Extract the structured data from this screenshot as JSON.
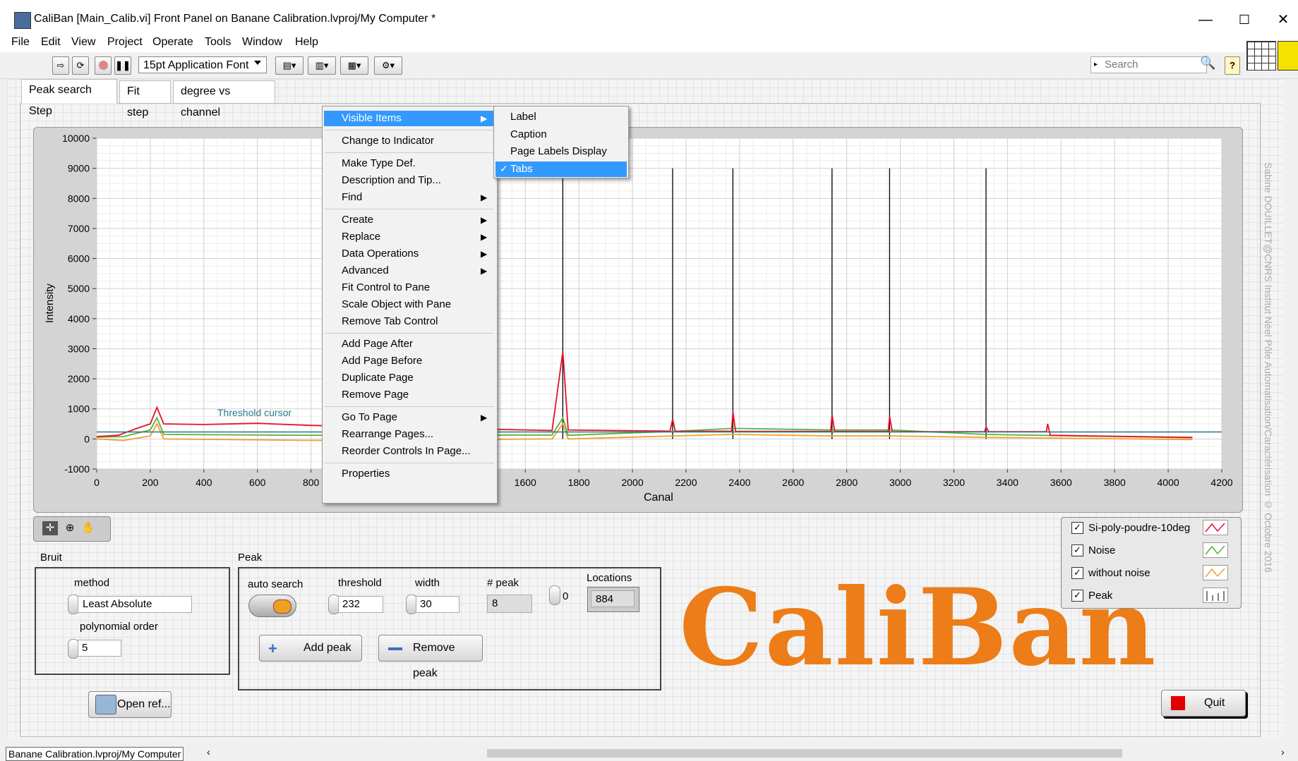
{
  "window": {
    "title": "CaliBan [Main_Calib.vi] Front Panel on Banane Calibration.lvproj/My Computer *",
    "minimize": "—",
    "maximize": "☐",
    "close": "✕"
  },
  "menubar": [
    "File",
    "Edit",
    "View",
    "Project",
    "Operate",
    "Tools",
    "Window",
    "Help"
  ],
  "toolbar": {
    "font": "15pt Application Font",
    "search_placeholder": "Search",
    "help": "?"
  },
  "tabs": [
    "Peak search Step",
    "Fit step",
    "degree vs channel"
  ],
  "graph": {
    "ylabel": "Intensity",
    "xlabel": "Canal",
    "threshold_label": "Threshold cursor",
    "yticks": [
      "10000",
      "9000",
      "8000",
      "7000",
      "6000",
      "5000",
      "4000",
      "3000",
      "2000",
      "1000",
      "0",
      "-1000"
    ],
    "xticks": [
      "0",
      "200",
      "400",
      "600",
      "800",
      "1000",
      "1200",
      "1400",
      "1600",
      "1800",
      "2000",
      "2200",
      "2400",
      "2600",
      "2800",
      "3000",
      "3200",
      "3400",
      "3600",
      "3800",
      "4000",
      "4200"
    ]
  },
  "chart_data": {
    "type": "line",
    "xlabel": "Canal",
    "ylabel": "Intensity",
    "xlim": [
      0,
      4200
    ],
    "ylim": [
      -1000,
      10000
    ],
    "threshold": 232,
    "peak_markers_x": [
      1740,
      2150,
      2375,
      2745,
      2960,
      3320
    ],
    "series": [
      {
        "name": "Si-poly-poudre-10deg",
        "color": "#e8102a",
        "points": [
          [
            0,
            80
          ],
          [
            80,
            120
          ],
          [
            150,
            350
          ],
          [
            200,
            500
          ],
          [
            225,
            1050
          ],
          [
            250,
            500
          ],
          [
            400,
            480
          ],
          [
            600,
            520
          ],
          [
            800,
            450
          ],
          [
            1700,
            280
          ],
          [
            1740,
            2900
          ],
          [
            1760,
            300
          ],
          [
            2140,
            260
          ],
          [
            2150,
            650
          ],
          [
            2160,
            250
          ],
          [
            2370,
            260
          ],
          [
            2375,
            900
          ],
          [
            2385,
            250
          ],
          [
            2740,
            250
          ],
          [
            2745,
            800
          ],
          [
            2755,
            250
          ],
          [
            2955,
            250
          ],
          [
            2960,
            750
          ],
          [
            2970,
            240
          ],
          [
            3315,
            240
          ],
          [
            3320,
            400
          ],
          [
            3330,
            240
          ],
          [
            3545,
            240
          ],
          [
            3550,
            500
          ],
          [
            3560,
            120
          ],
          [
            4090,
            50
          ]
        ]
      },
      {
        "name": "Noise",
        "color": "#5cb03c",
        "points": [
          [
            0,
            60
          ],
          [
            100,
            80
          ],
          [
            200,
            300
          ],
          [
            225,
            700
          ],
          [
            250,
            150
          ],
          [
            800,
            120
          ],
          [
            1700,
            130
          ],
          [
            1740,
            700
          ],
          [
            1760,
            120
          ],
          [
            2150,
            250
          ],
          [
            2375,
            350
          ],
          [
            2745,
            300
          ],
          [
            2960,
            300
          ],
          [
            3320,
            150
          ],
          [
            4090,
            40
          ]
        ]
      },
      {
        "name": "without noise",
        "color": "#f0a030",
        "points": [
          [
            0,
            0
          ],
          [
            100,
            -50
          ],
          [
            200,
            100
          ],
          [
            225,
            500
          ],
          [
            250,
            0
          ],
          [
            800,
            -50
          ],
          [
            1700,
            0
          ],
          [
            1740,
            500
          ],
          [
            1760,
            0
          ],
          [
            2150,
            100
          ],
          [
            2375,
            150
          ],
          [
            2745,
            100
          ],
          [
            2960,
            100
          ],
          [
            3320,
            50
          ],
          [
            4090,
            -20
          ]
        ]
      }
    ]
  },
  "context_menu": {
    "items": [
      {
        "label": "Visible Items",
        "submenu": true,
        "selected": true
      },
      {
        "sep": true
      },
      {
        "label": "Change to Indicator"
      },
      {
        "sep": true
      },
      {
        "label": "Make Type Def."
      },
      {
        "label": "Description and Tip..."
      },
      {
        "label": "Find",
        "submenu": true
      },
      {
        "sep": true
      },
      {
        "label": "Create",
        "submenu": true
      },
      {
        "label": "Replace",
        "submenu": true
      },
      {
        "label": "Data Operations",
        "submenu": true
      },
      {
        "label": "Advanced",
        "submenu": true
      },
      {
        "label": "Fit Control to Pane"
      },
      {
        "label": "Scale Object with Pane"
      },
      {
        "label": "Remove Tab Control"
      },
      {
        "sep": true
      },
      {
        "label": "Add Page After"
      },
      {
        "label": "Add Page Before"
      },
      {
        "label": "Duplicate Page"
      },
      {
        "label": "Remove Page"
      },
      {
        "sep": true
      },
      {
        "label": "Go To Page",
        "submenu": true
      },
      {
        "label": "Rearrange Pages..."
      },
      {
        "label": "Reorder Controls In Page..."
      },
      {
        "sep": true
      },
      {
        "label": "Properties"
      }
    ],
    "submenu_items": [
      {
        "label": "Label",
        "checked": false
      },
      {
        "label": "Caption",
        "checked": false
      },
      {
        "label": "Page Labels Display",
        "checked": false
      },
      {
        "label": "Tabs",
        "checked": true
      }
    ]
  },
  "bruit": {
    "title": "Bruit",
    "method_label": "method",
    "method_value": "Least Absolute",
    "poly_label": "polynomial order",
    "poly_value": "5"
  },
  "peak": {
    "title": "Peak",
    "auto_search_label": "auto search",
    "threshold_label": "threshold",
    "threshold_value": "232",
    "width_label": "width",
    "width_value": "30",
    "npeak_label": "# peak",
    "npeak_value": "8",
    "locations_label": "Locations",
    "locations_index": "0",
    "locations_value": "884",
    "add_peak": "Add peak",
    "remove_peak": "Remove peak"
  },
  "open_ref": "Open ref...",
  "quit": "Quit",
  "logo": "CaliBan",
  "legend": [
    {
      "label": "Si-poly-poudre-10deg",
      "color": "#e8102a",
      "checked": true
    },
    {
      "label": "Noise",
      "color": "#5cb03c",
      "checked": true
    },
    {
      "label": "without noise",
      "color": "#f0a030",
      "checked": true
    },
    {
      "label": "Peak",
      "color": "#000000",
      "checked": true
    }
  ],
  "watermark": "Sabine DOUILLET@CNRS Institut Néel Pôle Automatisation/Caractérisation © Octobre 2016",
  "status": "Banane Calibration.lvproj/My Computer"
}
